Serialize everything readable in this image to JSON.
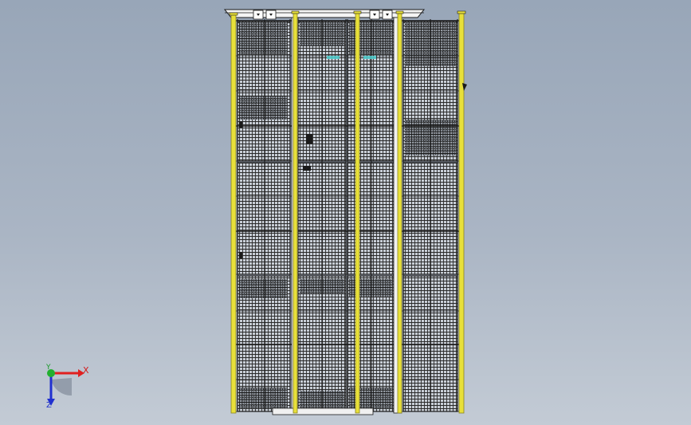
{
  "viewport": {
    "background_top": "#98a6b8",
    "background_bottom": "#c3cbd5",
    "model": "cage-structure-front-view"
  },
  "colors": {
    "line": "#1a1a1a",
    "mesh": "#2a2a2a",
    "yellow_post": "#e8e03a",
    "yellow_edge": "#8a8420",
    "white_part": "#f4f4f4",
    "cyan_accent": "#4fd7d7"
  },
  "triad": {
    "x_label": "X",
    "y_label": "Y",
    "z_label": "Z",
    "x_color": "#e02020",
    "y_color": "#22b030",
    "z_color": "#2030d0"
  }
}
